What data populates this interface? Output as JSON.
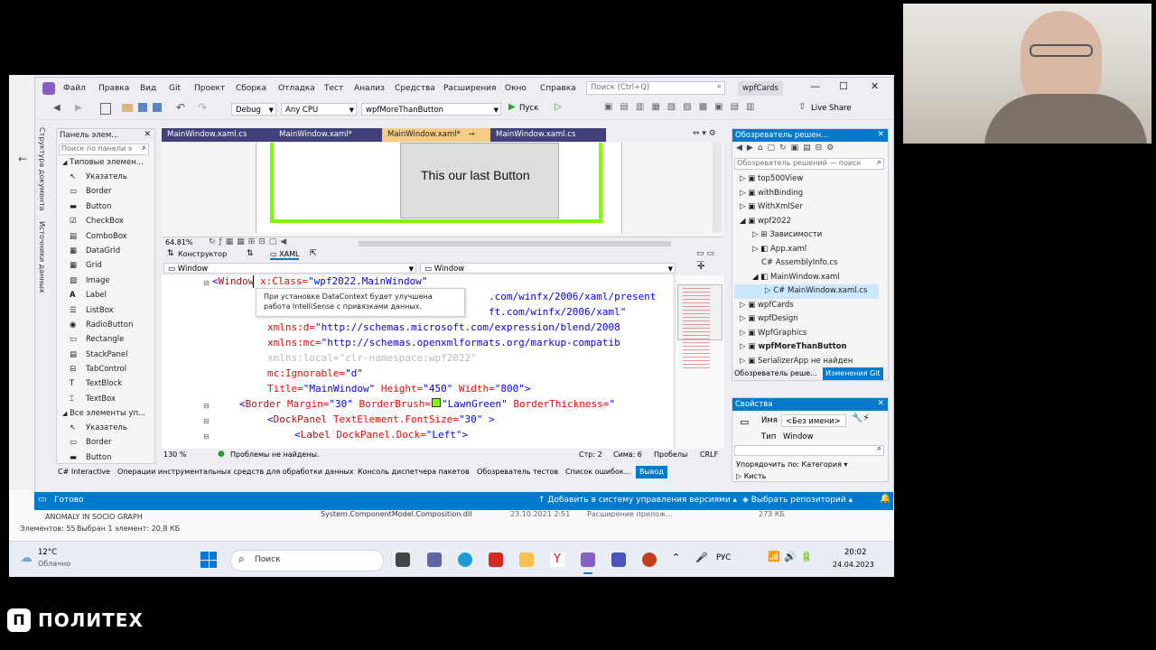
{
  "brand": {
    "logo": "ПОЛИТЕХ"
  },
  "vs": {
    "menu": [
      "Файл",
      "Правка",
      "Вид",
      "Git",
      "Проект",
      "Сборка",
      "Отладка",
      "Тест",
      "Анализ",
      "Средства",
      "Расширения",
      "Окно",
      "Справка"
    ],
    "search_placeholder": "Поиск (Ctrl+Q)",
    "project_badge": "wpfCards",
    "config": "Debug",
    "platform": "Any CPU",
    "startup": "wpfMoreThanButton",
    "run": "Пуск",
    "live_share": "Live Share"
  },
  "toolbox": {
    "title": "Панель элем...",
    "search": "Поиск по панели э",
    "group1": "Типовые элемен...",
    "items": [
      "Указатель",
      "Border",
      "Button",
      "CheckBox",
      "ComboBox",
      "DataGrid",
      "Grid",
      "Image",
      "Label",
      "ListBox",
      "RadioButton",
      "Rectangle",
      "StackPanel",
      "TabControl",
      "TextBlock",
      "TextBox"
    ],
    "group2": "Все элементы уп...",
    "items2": [
      "Указатель",
      "Border",
      "Button"
    ],
    "side_tabs": [
      "Структура документа",
      "Источники данных"
    ]
  },
  "editor": {
    "tabs": [
      "MainWindow.xaml.cs",
      "MainWindow.xaml*",
      "MainWindow.xaml*",
      "MainWindow.xaml.cs"
    ],
    "designer_button_text": "This our last Button",
    "zoom": "64.81%",
    "constructor": "Конструктор",
    "xaml": "XAML",
    "nav_left": "Window",
    "nav_right": "Window",
    "tooltip": "При установке DataContext будет улучшена работа IntelliSense с привязками данных.",
    "zoom_code": "130 %",
    "problems": "Проблемы не найдены.",
    "line": "Стр: 2",
    "col": "Симв: 6",
    "spaces": "Пробелы",
    "eol": "CRLF",
    "code": {
      "l1a": "<",
      "l1k": "Window",
      "l1b": " x:Class=",
      "l1v": "\"wpf2022.MainWindow\"",
      "l2": ".com/winfx/2006/xaml/present",
      "l3": "ft.com/winfx/2006/xaml\"",
      "l4a": "xmlns:d=",
      "l4v": "\"http://schemas.microsoft.com/expression/blend/2008",
      "l5a": "xmlns:mc=",
      "l5v": "\"http://schemas.openxmlformats.org/markup-compatib",
      "l6a": "xmlns:local=",
      "l6v": "\"clr-namespace:wpf2022\"",
      "l7a": "mc:Ignorable=",
      "l7v": "\"d\"",
      "l8a": "Title=",
      "l8v": "\"MainWindow\"",
      "l8b": " Height=",
      "l8c": "\"450\"",
      "l8d": " Width=",
      "l8e": "\"800\"",
      "l8f": ">",
      "l9a": "<",
      "l9k": "Border",
      "l9b": " Margin=",
      "l9c": "\"30\"",
      "l9d": " BorderBrush=",
      "l9e": "\"LawnGreen\"",
      "l9f": " BorderThickness=",
      "l9g": "\"",
      "l10a": "<",
      "l10k": "DockPanel",
      "l10b": " TextElement.FontSize=",
      "l10c": "\"30\"",
      "l10d": " >",
      "l11a": "<",
      "l11k": "Label",
      "l11b": " DockPanel.Dock=",
      "l11c": "\"Left\"",
      "l11d": ">"
    }
  },
  "solution": {
    "title": "Обозреватель решен...",
    "search": "Обозреватель решений — поиск",
    "items": [
      "top500View",
      "withBinding",
      "WithXmlSer",
      "wpf2022",
      "Зависимости",
      "App.xaml",
      "AssemblyInfo.cs",
      "MainWindow.xaml",
      "MainWindow.xaml.cs",
      "wpfCards",
      "wpfDesign",
      "WpfGraphics",
      "wpfMoreThanButton",
      "SerializerApp не найден"
    ],
    "tab1": "Обозреватель реше...",
    "tab2": "Изменения Git"
  },
  "properties": {
    "title": "Свойства",
    "name_label": "Имя",
    "name_value": "<Без имени>",
    "type_label": "Тип",
    "type_value": "Window",
    "sort": "Упорядочить по: Категория",
    "brush": "Кисть"
  },
  "bottom_tabs": [
    "C# Interactive",
    "Операции инструментальных средств для обработки данных",
    "Консоль диспетчера пакетов",
    "Обозреватель тестов",
    "Список ошибок...",
    "Вывод"
  ],
  "status": {
    "ready": "Готово",
    "scm": "Добавить в систему управления версиями",
    "repo": "Выбрать репозиторий"
  },
  "explorer_bg": {
    "items_count": "Элементов: 55",
    "selected": "Выбран 1 элемент: 20,8 КБ",
    "file": "System.ComponentModel.Composition.dll",
    "date": "23.10.2021 2:51",
    "kind": "Расширение прилож...",
    "size": "273 КБ",
    "anomaly": "ANOMALY IN SOCIO GRAPH"
  },
  "taskbar": {
    "temp": "12°C",
    "weather": "Облачно",
    "search": "Поиск",
    "lang": "РУС",
    "time": "20:02",
    "date": "24.04.2023"
  }
}
